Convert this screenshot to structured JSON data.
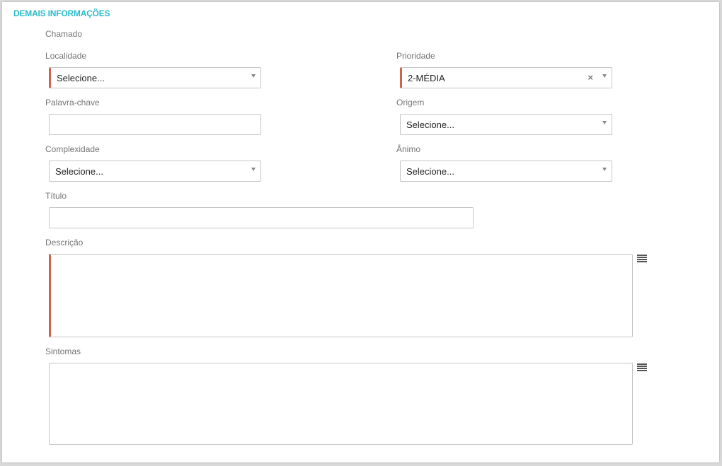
{
  "section": {
    "title": "DEMAIS INFORMAÇÕES"
  },
  "fields": {
    "chamado": {
      "label": "Chamado"
    },
    "localidade": {
      "label": "Localidade",
      "value": "Selecione..."
    },
    "prioridade": {
      "label": "Prioridade",
      "value": "2-MÉDIA",
      "clear": "×"
    },
    "palavra_chave": {
      "label": "Palavra-chave",
      "value": ""
    },
    "origem": {
      "label": "Origem",
      "value": "Selecione..."
    },
    "complexidade": {
      "label": "Complexidade",
      "value": "Selecione..."
    },
    "animo": {
      "label": "Ânimo",
      "value": "Selecione..."
    },
    "titulo": {
      "label": "Título",
      "value": ""
    },
    "descricao": {
      "label": "Descrição",
      "value": ""
    },
    "sintomas": {
      "label": "Sintomas",
      "value": ""
    }
  },
  "icons": {
    "descricao_menu": "menu-icon",
    "sintomas_menu": "menu-icon"
  },
  "colors": {
    "accent": "#2bbbcb",
    "required_marker": "#d0644a",
    "border": "#c6c6c6"
  }
}
